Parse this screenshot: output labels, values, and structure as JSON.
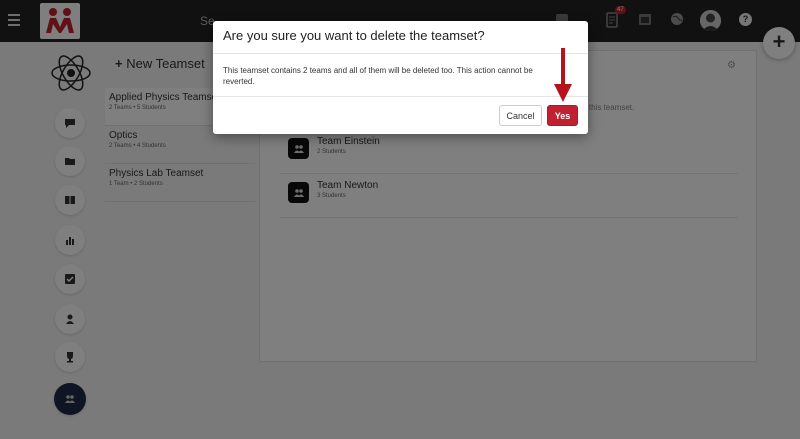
{
  "topbar": {
    "search_text": "Se",
    "notification_count": "47"
  },
  "sidebar": {
    "new_teamset_label": "New Teamset",
    "teamsets": [
      {
        "title": "Applied Physics Teamset",
        "meta": "2 Teams • 5 Students"
      },
      {
        "title": "Optics",
        "meta": "2 Teams • 4 Students"
      },
      {
        "title": "Physics Lab Teamset",
        "meta": "1 Team • 2 Students"
      }
    ]
  },
  "main": {
    "hint_text": "r this teamset.",
    "teams": [
      {
        "name": "Team Einstein",
        "meta": "2 Students"
      },
      {
        "name": "Team Newton",
        "meta": "3 Students"
      }
    ]
  },
  "modal": {
    "title": "Are you sure you want to delete the teamset?",
    "body": "This teamset contains 2 teams and all of them will be deleted too. This action cannot be reverted.",
    "cancel_label": "Cancel",
    "yes_label": "Yes"
  },
  "colors": {
    "accent_red": "#c0202f",
    "topbar_bg": "#222222",
    "active_rail": "#1e2a44"
  }
}
